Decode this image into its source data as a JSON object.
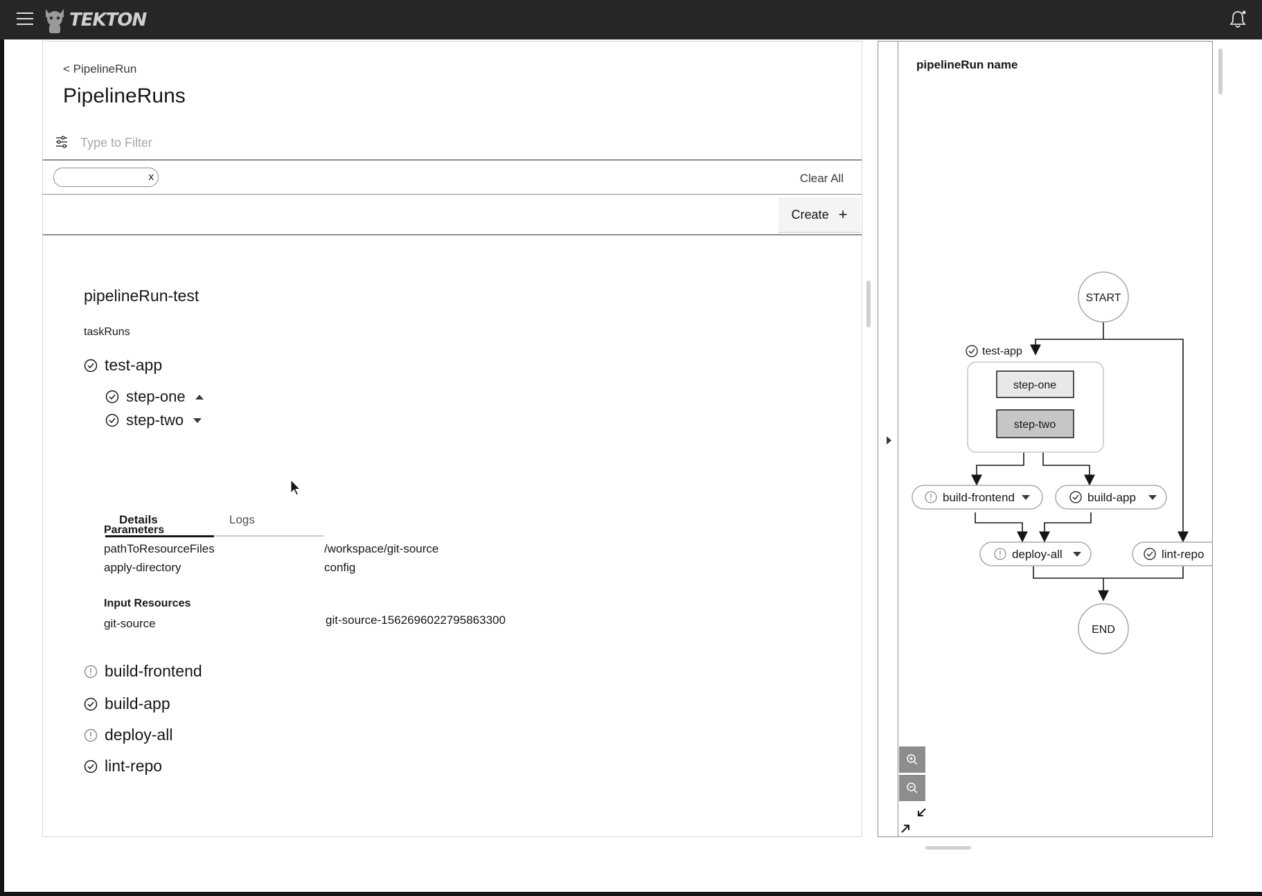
{
  "topbar": {
    "logo_text": "TEKTON"
  },
  "main": {
    "back_link": "< PipelineRun",
    "title": "PipelineRuns",
    "filter_placeholder": "Type to Filter",
    "tag_close": "x",
    "clear_all": "Clear All",
    "create_label": "Create",
    "create_plus": "+",
    "pipeline_run_name": "pipelineRun-test",
    "taskruns_label": "taskRuns",
    "tasks": [
      {
        "name": "test-app",
        "status": "success"
      },
      {
        "name": "build-frontend",
        "status": "warning"
      },
      {
        "name": "build-app",
        "status": "success"
      },
      {
        "name": "deploy-all",
        "status": "warning"
      },
      {
        "name": "lint-repo",
        "status": "success"
      }
    ],
    "steps": [
      {
        "name": "step-one",
        "status": "success",
        "expanded": true
      },
      {
        "name": "step-two",
        "status": "success",
        "expanded": false
      }
    ],
    "tabs": {
      "details": "Details",
      "logs": "Logs",
      "active": "Details"
    },
    "parameters_title": "Parameters",
    "parameters": [
      {
        "key": "pathToResourceFiles",
        "value": "/workspace/git-source"
      },
      {
        "key": "apply-directory",
        "value": "config"
      }
    ],
    "input_resources_title": "Input Resources",
    "input_resources": [
      {
        "key": "git-source",
        "value": "git-source-1562696022795863300"
      }
    ]
  },
  "side": {
    "title": "pipelineRun name",
    "graph": {
      "start": "START",
      "end": "END",
      "group_label": "test-app",
      "steps": [
        "step-one",
        "step-two"
      ],
      "nodes": {
        "build_frontend": "build-frontend",
        "build_app": "build-app",
        "deploy_all": "deploy-all",
        "lint_repo": "lint-repo"
      }
    }
  }
}
